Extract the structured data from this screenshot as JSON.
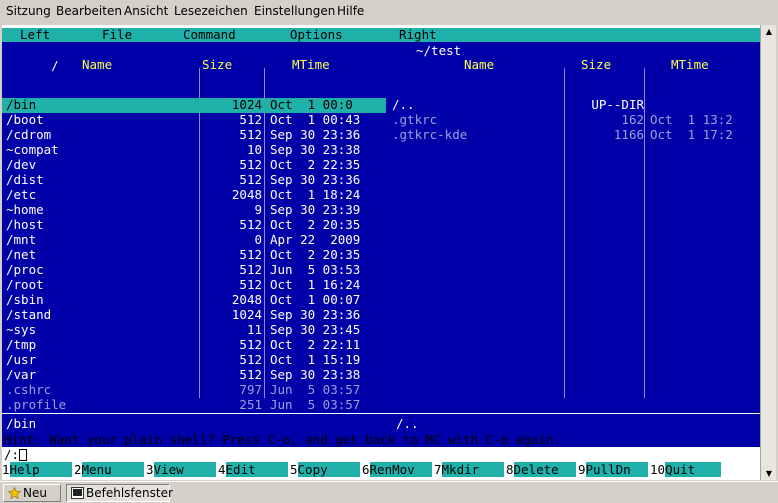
{
  "app_menu": [
    "Sitzung",
    "Bearbeiten",
    "Ansicht",
    "Lesezeichen",
    "Einstellungen",
    "Hilfe"
  ],
  "mc_menu": [
    "Left",
    "File",
    "Command",
    "Options",
    "Right"
  ],
  "left_panel": {
    "path": "/",
    "columns": [
      "Name",
      "Size",
      "MTime"
    ],
    "rows": [
      {
        "name": "/bin",
        "size": "1024",
        "mtime": "Oct  1 00:0"
      },
      {
        "name": "/boot",
        "size": "512",
        "mtime": "Oct  1 00:43"
      },
      {
        "name": "/cdrom",
        "size": "512",
        "mtime": "Sep 30 23:36"
      },
      {
        "name": "~compat",
        "size": "10",
        "mtime": "Sep 30 23:38"
      },
      {
        "name": "/dev",
        "size": "512",
        "mtime": "Oct  2 22:35"
      },
      {
        "name": "/dist",
        "size": "512",
        "mtime": "Sep 30 23:36"
      },
      {
        "name": "/etc",
        "size": "2048",
        "mtime": "Oct  1 18:24"
      },
      {
        "name": "~home",
        "size": "9",
        "mtime": "Sep 30 23:39"
      },
      {
        "name": "/host",
        "size": "512",
        "mtime": "Oct  2 20:35"
      },
      {
        "name": "/mnt",
        "size": "0",
        "mtime": "Apr 22  2009"
      },
      {
        "name": "/net",
        "size": "512",
        "mtime": "Oct  2 20:35"
      },
      {
        "name": "/proc",
        "size": "512",
        "mtime": "Jun  5 03:53"
      },
      {
        "name": "/root",
        "size": "512",
        "mtime": "Oct  1 16:24"
      },
      {
        "name": "/sbin",
        "size": "2048",
        "mtime": "Oct  1 00:07"
      },
      {
        "name": "/stand",
        "size": "1024",
        "mtime": "Sep 30 23:36"
      },
      {
        "name": "~sys",
        "size": "11",
        "mtime": "Sep 30 23:45"
      },
      {
        "name": "/tmp",
        "size": "512",
        "mtime": "Oct  2 22:11"
      },
      {
        "name": "/usr",
        "size": "512",
        "mtime": "Oct  1 15:19"
      },
      {
        "name": "/var",
        "size": "512",
        "mtime": "Sep 30 23:38"
      },
      {
        "name": ".cshrc",
        "size": "797",
        "mtime": "Jun  5 03:57"
      },
      {
        "name": ".profile",
        "size": "251",
        "mtime": "Jun  5 03:57"
      }
    ],
    "status": "/bin"
  },
  "right_panel": {
    "path": "~/test",
    "columns": [
      "Name",
      "Size",
      "MTime"
    ],
    "rows": [
      {
        "name": "/..",
        "size": "UP--DIR",
        "mtime": ""
      },
      {
        "name": ".gtkrc",
        "size": "162",
        "mtime": "Oct  1 13:2"
      },
      {
        "name": ".gtkrc-kde",
        "size": "1166",
        "mtime": "Oct  1 17:2"
      }
    ],
    "status": "/.."
  },
  "hint": "Hint: Want your plain shell? Press C-o, and get back to MC with C-o again.",
  "prompt": "/:",
  "fkeys": [
    {
      "num": "1",
      "label": "Help"
    },
    {
      "num": "2",
      "label": "Menu"
    },
    {
      "num": "3",
      "label": "View"
    },
    {
      "num": "4",
      "label": "Edit"
    },
    {
      "num": "5",
      "label": "Copy"
    },
    {
      "num": "6",
      "label": "RenMov"
    },
    {
      "num": "7",
      "label": "Mkdir"
    },
    {
      "num": "8",
      "label": "Delete"
    },
    {
      "num": "9",
      "label": "PullDn"
    },
    {
      "num": "10",
      "label": "Quit"
    }
  ],
  "taskbar": {
    "new_label": "Neu",
    "tab_label": "Befehlsfenster"
  },
  "colors": {
    "panel_bg": "#0000a8",
    "accent": "#1fb0aa",
    "header": "#ffff55"
  }
}
